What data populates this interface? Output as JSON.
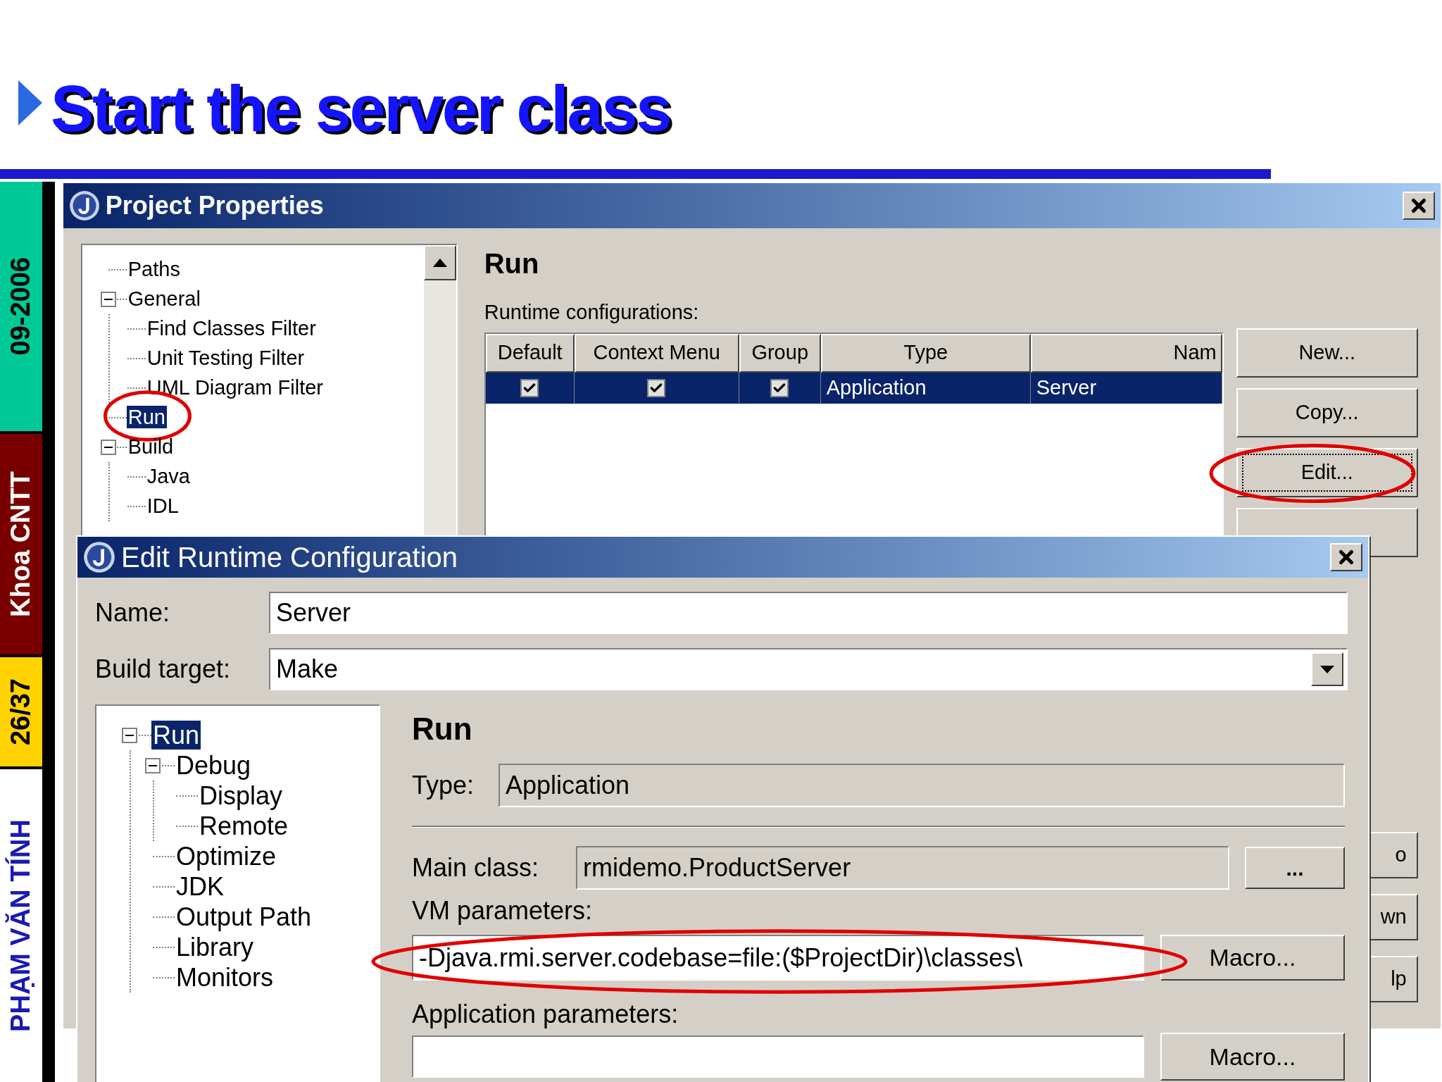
{
  "slide": {
    "title": "Start the server class",
    "side_labels": [
      {
        "text": "09-2006",
        "color": "#00c896"
      },
      {
        "text": "Khoa CNTT",
        "color": "#7a0000"
      },
      {
        "text": "26/37",
        "color": "#ffd200"
      },
      {
        "text": "PHẠM VĂN TÍNH",
        "color": "#ffffff"
      }
    ]
  },
  "project_properties": {
    "title": "Project Properties",
    "tree": [
      {
        "label": "Paths",
        "selected": false,
        "circled": false
      },
      {
        "label": "General",
        "selected": false,
        "circled": false,
        "expanded": true,
        "children": [
          {
            "label": "Find Classes Filter",
            "selected": false,
            "circled": false
          },
          {
            "label": "Unit Testing Filter",
            "selected": false,
            "circled": false
          },
          {
            "label": "UML Diagram Filter",
            "selected": false,
            "circled": false
          }
        ]
      },
      {
        "label": "Run",
        "selected": true,
        "circled": true
      },
      {
        "label": "Build",
        "selected": false,
        "circled": false,
        "expanded": true,
        "children": [
          {
            "label": "Java",
            "selected": false,
            "circled": false
          },
          {
            "label": "IDL",
            "selected": false,
            "circled": false
          }
        ]
      }
    ],
    "section_title": "Run",
    "table_label": "Runtime configurations:",
    "table": {
      "columns": [
        "Default",
        "Context Menu",
        "Group",
        "Type",
        "Nam"
      ],
      "rows": [
        {
          "selected": true,
          "cells": [
            {
              "kind": "checkbox",
              "checked": true
            },
            {
              "kind": "checkbox",
              "checked": true
            },
            {
              "kind": "checkbox",
              "checked": true
            },
            {
              "kind": "text",
              "text": "Application"
            },
            {
              "kind": "text",
              "text": "Server"
            }
          ]
        }
      ]
    },
    "buttons": [
      {
        "label": "New...",
        "focused": false,
        "circled": false
      },
      {
        "label": "Copy...",
        "focused": false,
        "circled": false
      },
      {
        "label": "Edit...",
        "focused": true,
        "circled": true
      },
      {
        "focused": false,
        "circled": false
      }
    ],
    "lower_buttons": [
      {
        "label": "o"
      },
      {
        "label": "wn"
      },
      {
        "label": "lp"
      }
    ]
  },
  "edit_dialog": {
    "title": "Edit Runtime Configuration",
    "name_label": "Name:",
    "name_value": "Server",
    "build_target_label": "Build target:",
    "build_target_value": "Make",
    "tree": [
      {
        "label": "Run",
        "selected": true,
        "circled": false,
        "expanded": true,
        "children": [
          {
            "label": "Debug",
            "selected": false,
            "circled": false,
            "expanded": true,
            "children": [
              {
                "label": "Display",
                "selected": false,
                "circled": false
              },
              {
                "label": "Remote",
                "selected": false,
                "circled": false
              }
            ]
          },
          {
            "label": "Optimize",
            "selected": false,
            "circled": false
          },
          {
            "label": "JDK",
            "selected": false,
            "circled": false
          },
          {
            "label": "Output Path",
            "selected": false,
            "circled": false
          },
          {
            "label": "Library",
            "selected": false,
            "circled": false
          },
          {
            "label": "Monitors",
            "selected": false,
            "circled": false
          }
        ]
      }
    ],
    "section_title": "Run",
    "type_label": "Type:",
    "type_value": "Application",
    "main_class_label": "Main class:",
    "main_class_value": "rmidemo.ProductServer",
    "browse_button": "...",
    "vm_label": "VM parameters:",
    "vm_value": "-Djava.rmi.server.codebase=file:($ProjectDir)\\classes\\",
    "vm_circled": true,
    "vm_macro_button": "Macro...",
    "app_label": "Application parameters:",
    "app_macro_button": "Macro..."
  }
}
